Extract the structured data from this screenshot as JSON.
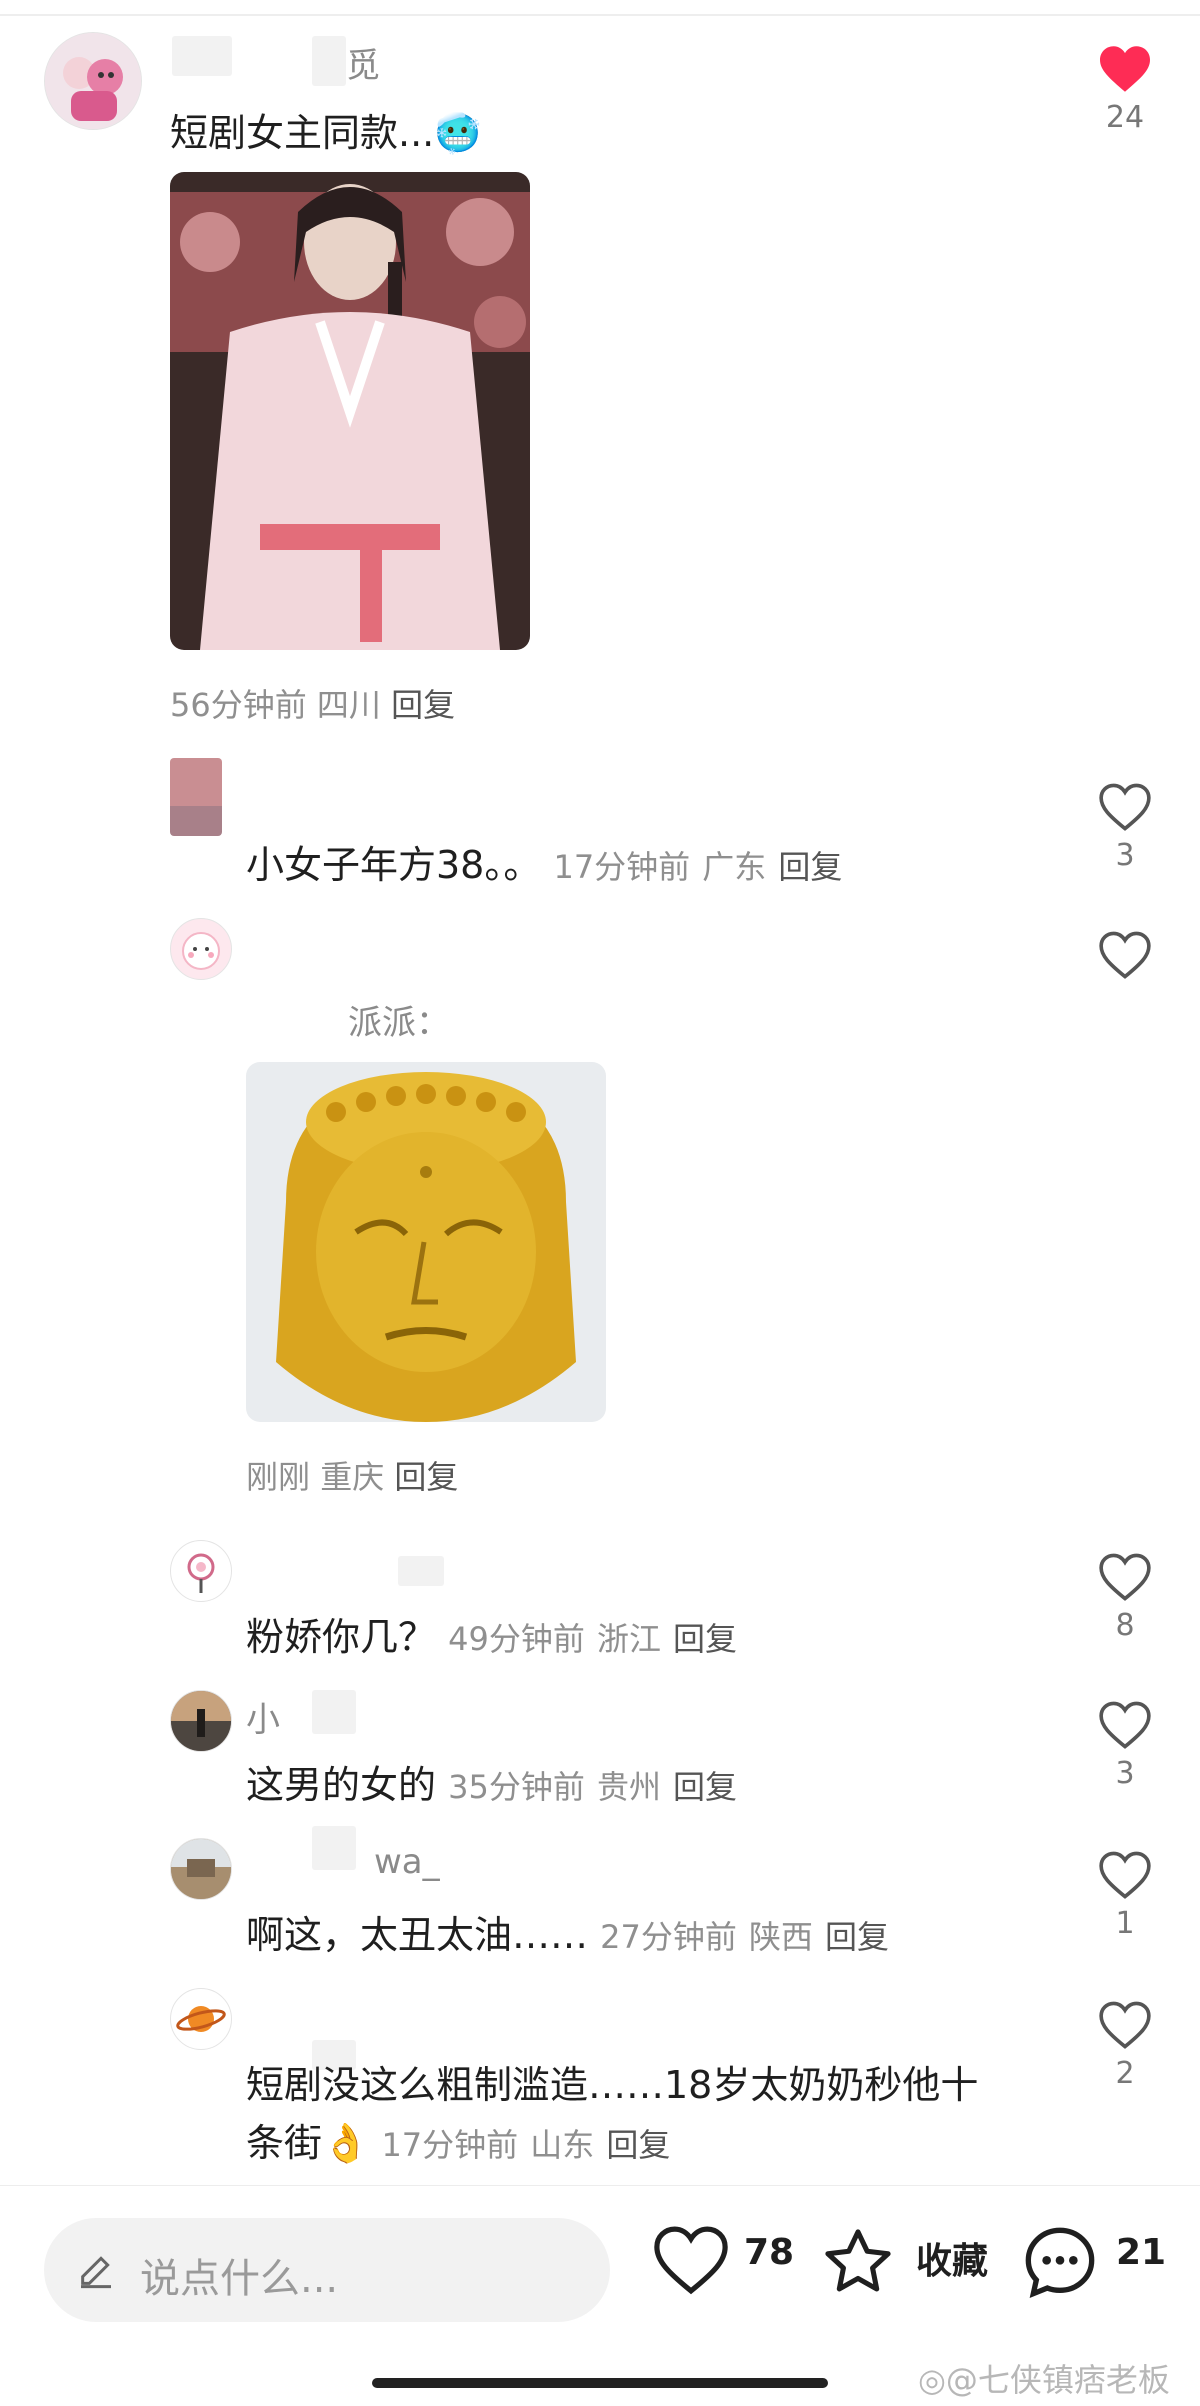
{
  "comments": [
    {
      "name_fragment": "觅",
      "text": "短剧女主同款...",
      "emoji": "🥶",
      "time": "56分钟前",
      "location": "四川",
      "reply": "回复",
      "likes": "24",
      "liked": true
    },
    {
      "text": "小女子年方38。。",
      "time": "17分钟前",
      "location": "广东",
      "reply": "回复",
      "likes": "3"
    },
    {
      "name_fragment": "派派：",
      "time": "刚刚",
      "location": "重庆",
      "reply": "回复",
      "likes": ""
    },
    {
      "text": "粉娇你几？",
      "time": "49分钟前",
      "location": "浙江",
      "reply": "回复",
      "likes": "8"
    },
    {
      "name_fragment": "小",
      "text": "这男的女的",
      "time": "35分钟前",
      "location": "贵州",
      "reply": "回复",
      "likes": "3"
    },
    {
      "name_fragment": "wa_",
      "text": "啊这，太丑太油……",
      "time": "27分钟前",
      "location": "陕西",
      "reply": "回复",
      "likes": "1"
    },
    {
      "text_line1": "短剧没这么粗制滥造……18岁太奶奶秒他十",
      "text_line2": "条街",
      "emoji": "👌",
      "time": "17分钟前",
      "location": "山东",
      "reply": "回复",
      "likes": "2"
    }
  ],
  "bottom_bar": {
    "input_placeholder": "说点什么...",
    "likes": "78",
    "collect_label": "收藏",
    "comments": "21"
  },
  "watermark": "七侠镇痞老板",
  "colors": {
    "liked_heart": "#fe2c55",
    "meta_gray": "#8f8f8f",
    "text": "#1f1f1f"
  },
  "icons": [
    "heart-icon",
    "edit-pen-icon",
    "star-icon",
    "comment-bubble-icon",
    "weibo-icon"
  ]
}
